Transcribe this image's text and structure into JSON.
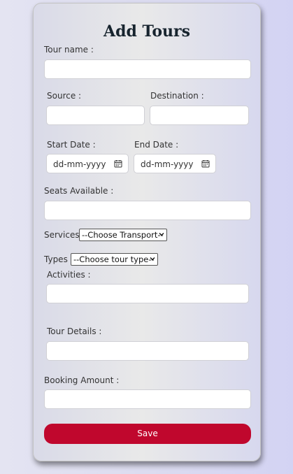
{
  "form": {
    "title": "Add Tours",
    "tour_name": {
      "label": "Tour name :",
      "value": ""
    },
    "source": {
      "label": "Source :",
      "value": ""
    },
    "destination": {
      "label": "Destination :",
      "value": ""
    },
    "start_date": {
      "label": "Start Date :",
      "placeholder": "dd-mm-yyyy"
    },
    "end_date": {
      "label": "End Date :",
      "placeholder": "dd-mm-yyyy"
    },
    "seats": {
      "label": "Seats Available :",
      "value": ""
    },
    "services": {
      "label": "Services",
      "selected": "--Choose Transport--"
    },
    "types": {
      "label": "Types",
      "selected": "--Choose tour type--"
    },
    "activities": {
      "label": "Activities :",
      "value": ""
    },
    "tour_details": {
      "label": "Tour Details :",
      "value": ""
    },
    "booking_amount": {
      "label": "Booking Amount :",
      "value": ""
    },
    "save_label": "Save"
  }
}
